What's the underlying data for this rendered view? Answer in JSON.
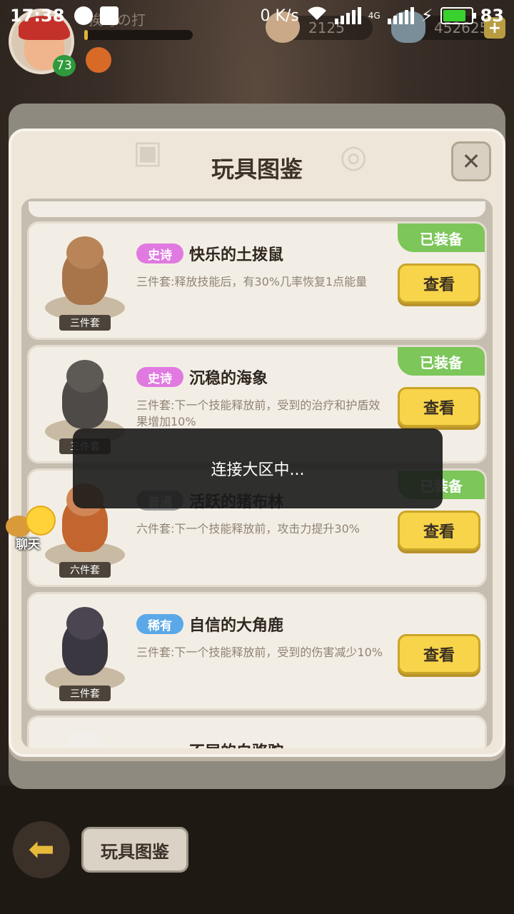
{
  "status_bar": {
    "time": "17:38",
    "net_speed": "0 K/s",
    "network_type": "4G",
    "battery_level": "83",
    "battery_fraction": 0.83
  },
  "hud": {
    "player_name": "挨毒の打",
    "level": "73",
    "xp_fraction": 0.03,
    "shells": "2125",
    "gems": "452625",
    "plus_label": "+"
  },
  "modal": {
    "title": "玩具图鉴",
    "close_label": "✕"
  },
  "toys": [
    {
      "rarity": "史诗",
      "rarity_type": "epic",
      "name": "快乐的土拨鼠",
      "description": "三件套:释放技能后，有30%几率恢复1点能量",
      "set_badge": "三件套",
      "button": "查看",
      "equipped": true,
      "equipped_label": "已装备",
      "colors": {
        "body": "#a8744a",
        "head": "#b98457"
      }
    },
    {
      "rarity": "史诗",
      "rarity_type": "epic",
      "name": "沉稳的海象",
      "description": "三件套:下一个技能释放前，受到的治疗和护盾效果增加10%",
      "set_badge": "三件套",
      "button": "查看",
      "equipped": true,
      "equipped_label": "已装备",
      "colors": {
        "body": "#4d4a47",
        "head": "#5d5955"
      }
    },
    {
      "rarity": "普通",
      "rarity_type": "common",
      "name": "活跃的猪布林",
      "description": "六件套:下一个技能释放前，攻击力提升30%",
      "set_badge": "六件套",
      "button": "查看",
      "equipped": true,
      "equipped_label": "已装备",
      "colors": {
        "body": "#c2652e",
        "head": "#d08657"
      }
    },
    {
      "rarity": "稀有",
      "rarity_type": "rare",
      "name": "自信的大角鹿",
      "description": "三件套:下一个技能释放前，受到的伤害减少10%",
      "set_badge": "三件套",
      "button": "查看",
      "equipped": false,
      "equipped_label": "",
      "colors": {
        "body": "#3b3740",
        "head": "#4a4550"
      }
    },
    {
      "name": "不屈的白骆驼",
      "partial": true
    }
  ],
  "toast": {
    "message": "连接大区中..."
  },
  "chat": {
    "label": "聊天"
  },
  "bottom": {
    "tab_label": "玩具图鉴"
  }
}
